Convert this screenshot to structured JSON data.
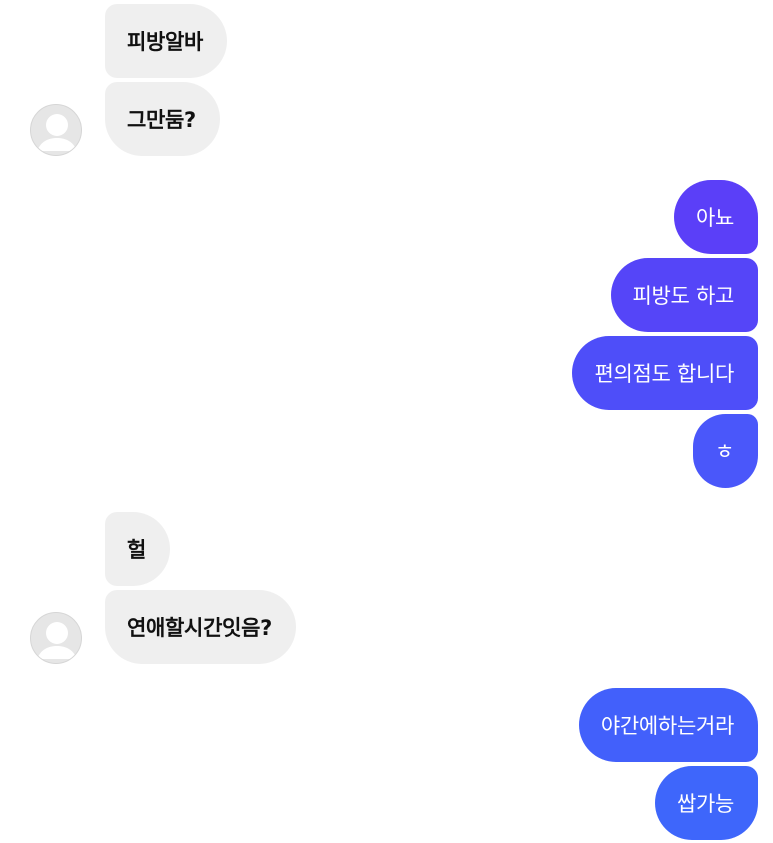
{
  "conversation": [
    {
      "sender": "other",
      "messages": [
        "피방알바",
        "그만둠?"
      ]
    },
    {
      "sender": "me",
      "messages": [
        "아뇨",
        "피방도 하고",
        "편의점도 합니다",
        "ㅎ"
      ]
    },
    {
      "sender": "other",
      "messages": [
        "헐",
        "연애할시간잇음?"
      ]
    },
    {
      "sender": "me",
      "messages": [
        "야간에하는거라",
        "쌉가능"
      ]
    }
  ],
  "colors": {
    "incoming_bubble": "#efefef",
    "incoming_text": "#111111",
    "outgoing_gradient_top": "#5b3ff8",
    "outgoing_gradient_bottom": "#3e63fb",
    "outgoing_text": "#ffffff",
    "avatar_bg": "#e6e6e6"
  },
  "icons": {
    "avatar": "default-profile-icon"
  }
}
